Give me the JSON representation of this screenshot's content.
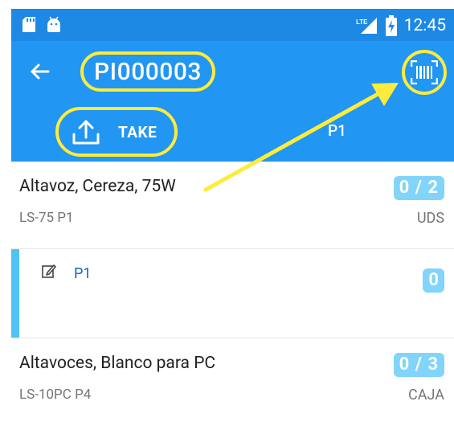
{
  "status_bar": {
    "time": "12:45",
    "icons": [
      "sd-card-icon",
      "android-icon",
      "lte-signal-icon",
      "battery-charging-icon"
    ]
  },
  "toolbar": {
    "title": "PI000003",
    "back_icon": "arrow-left-icon",
    "scan_icon": "barcode-scan-icon"
  },
  "tabs": [
    {
      "label": "TAKE",
      "icon": "upload-icon"
    },
    {
      "label": "P1"
    }
  ],
  "items": [
    {
      "name": "Altavoz, Cereza, 75W",
      "code": "LS-75 P1",
      "count": "0 / 2",
      "unit": "UDS",
      "sub_locations": [
        {
          "location": "P1",
          "count": "0",
          "icon": "edit-icon"
        }
      ]
    },
    {
      "name": "Altavoces, Blanco para PC",
      "code": "LS-10PC P4",
      "count": "0 / 3",
      "unit": "CAJA"
    }
  ],
  "colors": {
    "status_bar": "#1e88e5",
    "primary": "#2196f3",
    "badge": "#81d4fa",
    "highlight": "#ffeb3b",
    "sub_bar": "#4fc3f7",
    "link": "#1565c0"
  }
}
